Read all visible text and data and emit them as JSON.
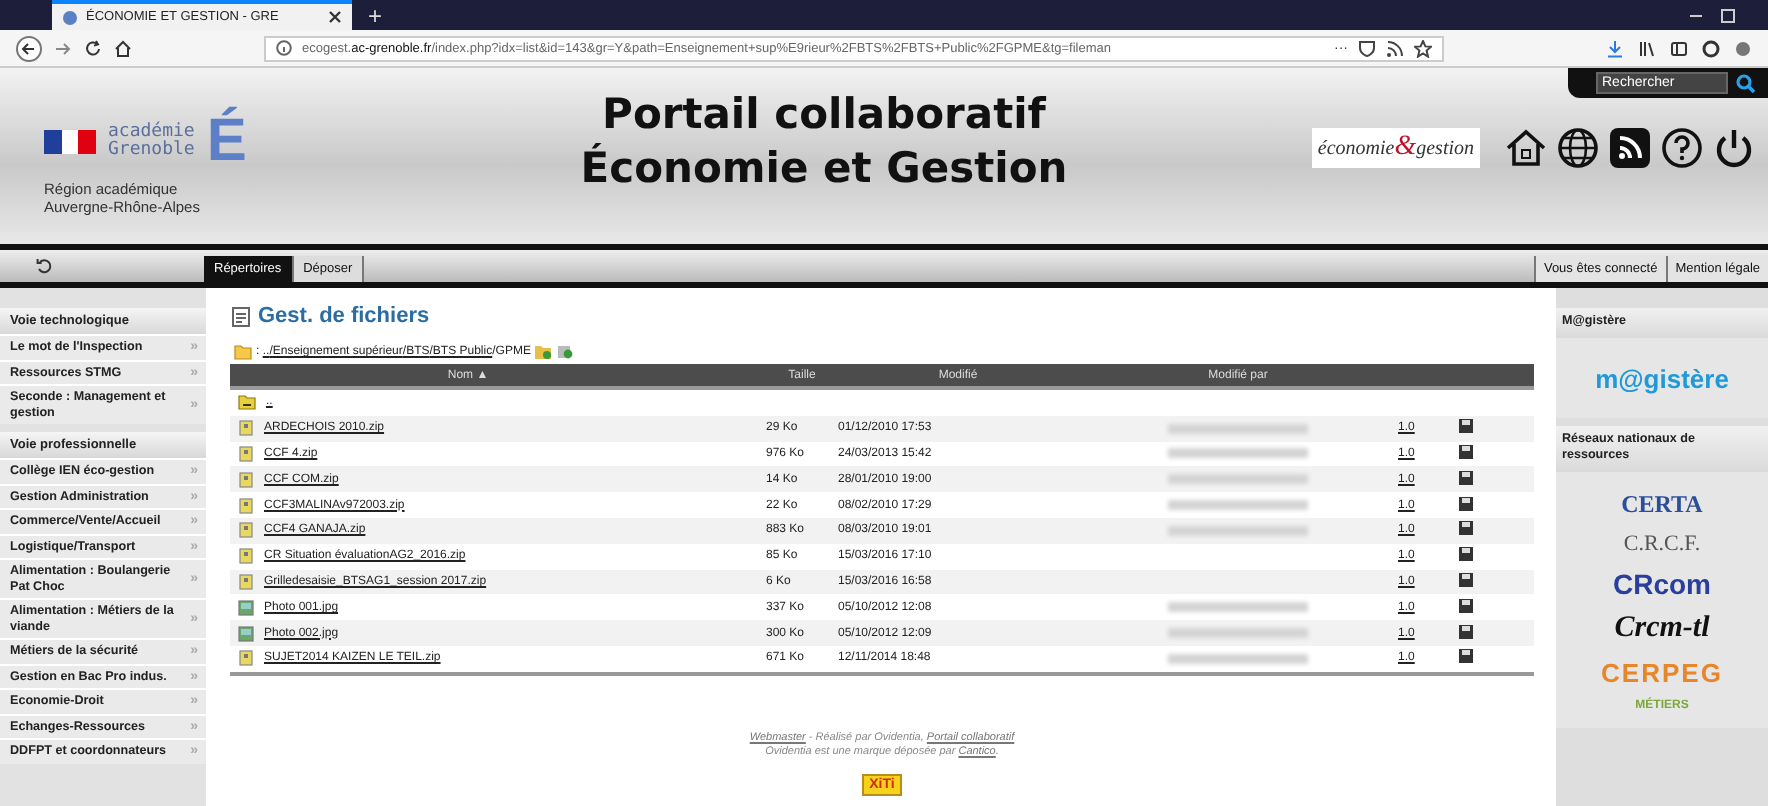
{
  "browser": {
    "tabs": [
      {
        "title": "ÉCONOMIE ET GESTION - GRE",
        "selected": true
      }
    ],
    "new_tab": "+",
    "url_prefix": "ecogest.",
    "url_domain": "ac-grenoble.fr",
    "url_rest": "/index.php?idx=list&id=143&gr=Y&path=Enseignement+sup%E9rieur%2FBTS%2FBTS+Public%2FGPME&tg=fileman",
    "more": "···"
  },
  "header": {
    "academie": "académie",
    "academie_city": "Grenoble",
    "academie_letter": "É",
    "region_line1": "Région académique",
    "region_line2": "Auvergne-Rhône-Alpes",
    "title_line1": "Portail collaboratif",
    "title_line2": "Économie et Gestion",
    "partner_logo_a": "économie",
    "partner_logo_amp": "&",
    "partner_logo_b": "gestion",
    "search_placeholder": "Rechercher"
  },
  "nav": {
    "tabs": [
      {
        "label": "Répertoires",
        "selected": true
      },
      {
        "label": "Déposer",
        "selected": false
      }
    ],
    "right_links": [
      "Vous êtes connecté",
      "Mention légale"
    ]
  },
  "sidebar": {
    "sections": [
      {
        "title": "Voie technologique",
        "items": [
          "Le mot de l'Inspection",
          "Ressources STMG",
          "Seconde : Management et gestion"
        ]
      },
      {
        "title": "Voie professionnelle",
        "items": [
          "Collège IEN éco-gestion",
          "Gestion Administration",
          "Commerce/Vente/Accueil",
          "Logistique/Transport",
          "Alimentation : Boulangerie Pat Choc",
          "Alimentation : Métiers de la viande",
          "Métiers de la sécurité",
          "Gestion en Bac Pro indus.",
          "Economie-Droit",
          "Echanges-Ressources",
          "DDFPT et coordonnateurs"
        ]
      }
    ],
    "chevron": "»"
  },
  "main": {
    "title": "Gest. de fichiers",
    "path_prefix": ": ",
    "path_links": [
      "..",
      "/Enseignement supérieur",
      "/BTS",
      "/BTS Public"
    ],
    "path_current": "/GPME",
    "columns": [
      "Nom ▲",
      "Taille",
      "Modifié",
      "Modifié par"
    ],
    "parent_row": "..",
    "rows": [
      {
        "kind": "zip",
        "name": "ARDECHOIS 2010.zip",
        "size": "29 Ko",
        "modified": "01/12/2010 17:53",
        "modifier_shown": true,
        "version": "1.0"
      },
      {
        "kind": "zip",
        "name": "CCF 4.zip",
        "size": "976 Ko",
        "modified": "24/03/2013 15:42",
        "modifier_shown": true,
        "version": "1.0"
      },
      {
        "kind": "zip",
        "name": "CCF COM.zip",
        "size": "14 Ko",
        "modified": "28/01/2010 19:00",
        "modifier_shown": true,
        "version": "1.0"
      },
      {
        "kind": "zip",
        "name": "CCF3MALINAv972003.zip",
        "size": "22 Ko",
        "modified": "08/02/2010 17:29",
        "modifier_shown": true,
        "version": "1.0"
      },
      {
        "kind": "zip",
        "name": "CCF4 GANAJA.zip",
        "size": "883 Ko",
        "modified": "08/03/2010 19:01",
        "modifier_shown": true,
        "version": "1.0"
      },
      {
        "kind": "zip",
        "name": "CR Situation évaluationAG2_2016.zip",
        "size": "85 Ko",
        "modified": "15/03/2016 17:10",
        "modifier_shown": false,
        "version": "1.0"
      },
      {
        "kind": "zip",
        "name": "Grilledesaisie_BTSAG1_session 2017.zip",
        "size": "6 Ko",
        "modified": "15/03/2016 16:58",
        "modifier_shown": false,
        "version": "1.0"
      },
      {
        "kind": "image",
        "name": "Photo 001.jpg",
        "size": "337 Ko",
        "modified": "05/10/2012 12:08",
        "modifier_shown": true,
        "version": "1.0"
      },
      {
        "kind": "image",
        "name": "Photo 002.jpg",
        "size": "300 Ko",
        "modified": "05/10/2012 12:09",
        "modifier_shown": true,
        "version": "1.0"
      },
      {
        "kind": "zip",
        "name": "SUJET2014 KAIZEN LE TEIL.zip",
        "size": "671 Ko",
        "modified": "12/11/2014 18:48",
        "modifier_shown": true,
        "version": "1.0"
      }
    ],
    "footer_webmaster": "Webmaster",
    "footer_text1": " - Réalisé par Ovidentia, ",
    "footer_link": "Portail collaboratif",
    "footer_text2": "Ovidentia est une marque déposée par ",
    "footer_cantico": "Cantico",
    "footer_end": ".",
    "xiti": "XiTi"
  },
  "right": {
    "sections": [
      {
        "title": "M@gistère",
        "logos": [
          {
            "kind": "magistere",
            "text": "m@gistère"
          }
        ]
      },
      {
        "title": "Réseaux nationaux de ressources",
        "logos": [
          {
            "kind": "certa",
            "text": "CERTA"
          },
          {
            "kind": "crcf",
            "text": "C.R.C.F."
          },
          {
            "kind": "crcom",
            "text": "CRcom"
          },
          {
            "kind": "crcm",
            "text": "Crcm-tl"
          },
          {
            "kind": "cerpeg",
            "text": "CERPEG"
          },
          {
            "kind": "metiers",
            "text": "MÉTIERS"
          }
        ]
      }
    ]
  }
}
